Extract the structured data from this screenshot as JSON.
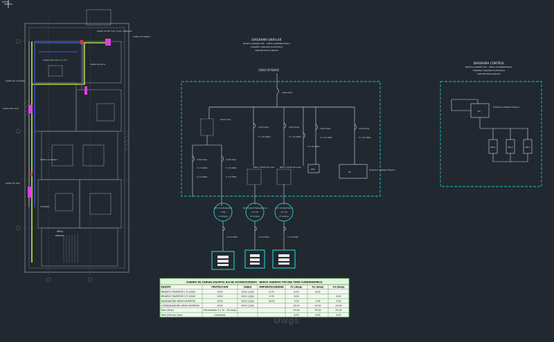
{
  "top_left_label": "DIF(L)",
  "plan": {
    "wall_label": "WALL",
    "area_label": "BIBIANO",
    "notes": [
      "Salida de BIT 3/4\" acero cableado",
      "Salida de tablero",
      "Salida PVC 3/4\" a 3 circ",
      "Cable de tierra",
      "Salida de canaleta",
      "Salida PVC 3/4\"",
      "Salida de tablero",
      "Salida de alim.",
      "Canaleta"
    ]
  },
  "single_line": {
    "title_lines": [
      "DIAGRAMA UNIFILAR",
      "BANCO AGRARIO DE - TEMA CUNDINAMARCA",
      "TABLERO TABLERO ELECTRICO",
      "ANE PROTECCIONADO"
    ],
    "supply": "208V/3F/60HZ",
    "main_breaker": "3x40 Amp",
    "meter": "3x15 Amp",
    "branches": [
      {
        "id": "b1",
        "breaker": "1x20 Amp",
        "cable": "3 x 10 AWG"
      },
      {
        "id": "b2",
        "breaker": "1x25 Amp",
        "cable": "3 x 10 AWG"
      },
      {
        "id": "b3",
        "breaker": "1x25 Amp",
        "cable": "3 x 10 AWG"
      },
      {
        "id": "b4",
        "breaker": "1x20 Amp",
        "cable": "3 x 10 AWG"
      },
      {
        "id": "b5",
        "breaker": "1x20 Amp",
        "cable": "3 x 10 AWG"
      }
    ],
    "sub_left": [
      {
        "breaker": "1x40 Amp",
        "cable": "3 x 8 AWG",
        "cable2": "3 x 8 AWG"
      },
      {
        "breaker": "1x30 Amp",
        "cable": "3 x 8 AWG",
        "cable2": "3 x 8 AWG"
      }
    ],
    "sub_mid": [
      {
        "label": "RRS-1 3X20-25 Amp"
      },
      {
        "label": "RRS-2 3X20-40 Amp"
      }
    ],
    "dpc_label": "DPC",
    "pv_label": "PV",
    "pv_note": "Protector Voltaje Trifasico",
    "units": [
      {
        "label": "A/C Condensador",
        "load": "3 TR",
        "circ": "(3 Amps)"
      },
      {
        "label": "A/C Unidad Manejadora",
        "load": "1.5 TR",
        "circ": "(3 Amps)"
      },
      {
        "label": "A/C Unidad Rack",
        "load": "1.5 TR",
        "circ": "(3 Amps)"
      }
    ],
    "unit_cable": "3 x 6 THW"
  },
  "control": {
    "title_lines": [
      "DIAGRAMA CONTROL",
      "BANCO AGRARIO DE - TEMA CUNDINAMARCA",
      "TABLERO TABLERO ELECTRICO",
      "ANE PROTECCIONADO"
    ],
    "pv_label": "PV",
    "pv_note": "Protector Voltaje Trifasico",
    "boxes": [
      "RR-1",
      "RR-2",
      "RR-3"
    ]
  },
  "table": {
    "title": "CUADRO DE CARGAS EQUIPOS A/A DE ACONDICIONADO - BANCO AGRARIO OFICINA TEMA CUNDINAMARCA",
    "headers": [
      "EQUIPO",
      "PROTECCION",
      "CABLE",
      "AMPERIOS/UNIDAD",
      "F1 (Amp)",
      "F2 (Amp)",
      "F3 (Amp)"
    ],
    "rows": [
      [
        "MINISPLIT INVERTER 1 R 12000",
        "1X20",
        "3X10 (L)(N)",
        "9.76",
        "8.00",
        "8.00",
        ""
      ],
      [
        "MINISPLIT INVERTER 2 R 12000",
        "1X20",
        "3X10 (L)(N)",
        "9.76",
        "8.00",
        "",
        "8.00"
      ],
      [
        "MANEJADORA 36000 INVERTER",
        "3X30",
        "3X10 (L)(N)",
        "18.00",
        "3.00",
        "3.00",
        "3.00"
      ],
      [
        "CONDENSADORA 36000 INVERTER",
        "3X30",
        "3X10 (L)(N)",
        "",
        "24.00",
        "24.00",
        "24.00"
      ],
      [
        "Total (Amp)",
        "Alimentador 3 x 10 - 40 Amps",
        "",
        "",
        "43.00",
        "35.00",
        "35.00"
      ],
      [
        "Total (kVA por fase)",
        "Conductor",
        "",
        "",
        "8.00",
        "6.00",
        "6.00"
      ]
    ]
  }
}
